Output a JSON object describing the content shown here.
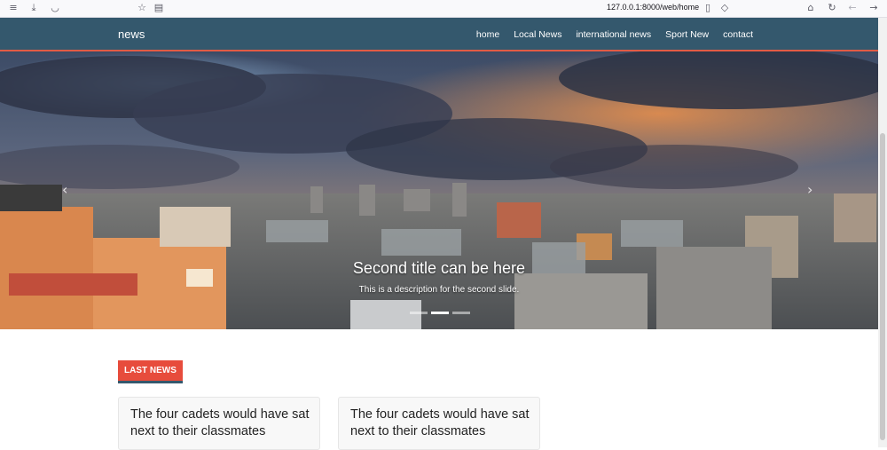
{
  "browser": {
    "url": "127.0.0.1:8000/web/home"
  },
  "navbar": {
    "brand": "news",
    "links": [
      "home",
      "Local News",
      "international news",
      "Sport New",
      "contact"
    ]
  },
  "carousel": {
    "title": "Second title can be here",
    "description": "This is a description for the second slide.",
    "slide_count": 3,
    "active_index": 1,
    "prev_glyph": "‹",
    "next_glyph": "›"
  },
  "section": {
    "badge": "LAST NEWS"
  },
  "cards": [
    {
      "title": "The four cadets would have sat next to their classmates"
    },
    {
      "title": "The four cadets would have sat next to their classmates"
    }
  ],
  "colors": {
    "navbar": "#34586d",
    "accent": "#e74c3c"
  }
}
